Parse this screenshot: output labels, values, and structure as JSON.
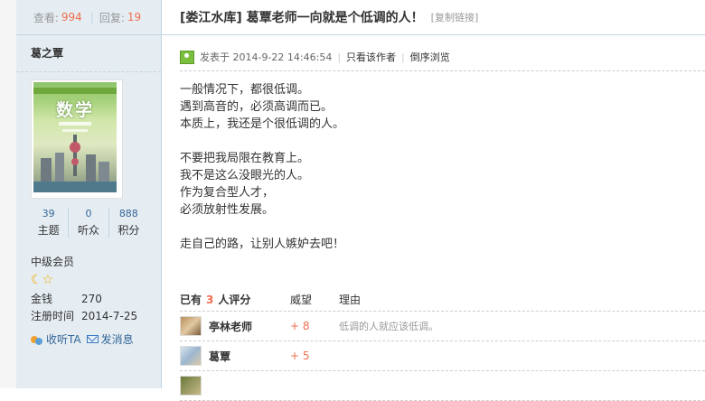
{
  "stats": {
    "views_label": "查看:",
    "views": "994",
    "replies_label": "回复:",
    "replies": "19"
  },
  "author": {
    "name": "葛之覃",
    "book_title": "数学",
    "counts": [
      {
        "value": "39",
        "label": "主题"
      },
      {
        "value": "0",
        "label": "听众"
      },
      {
        "value": "888",
        "label": "积分"
      }
    ],
    "level": "中级会员",
    "info": [
      {
        "key": "金钱",
        "value": "270"
      },
      {
        "key": "注册时间",
        "value": "2014-7-25"
      }
    ],
    "actions": {
      "follow": "收听TA",
      "message": "发消息"
    }
  },
  "thread": {
    "title": "[娄江水库] 葛覃老师一向就是个低调的人！",
    "copy_link": "[复制链接]"
  },
  "post": {
    "posted_at": "发表于 2014-9-22 14:46:54",
    "only_author": "只看该作者",
    "reverse": "倒序浏览",
    "lines": [
      "一般情况下，都很低调。",
      "遇到高音的，必须高调而已。",
      "本质上，我还是个很低调的人。",
      "",
      "不要把我局限在教育上。",
      "我不是这么没眼光的人。",
      "作为复合型人才，",
      "必须放射性发展。",
      "",
      "走自己的路，让别人嫉妒去吧！"
    ]
  },
  "rating": {
    "prefix": "已有",
    "count": "3",
    "suffix": "人评分",
    "col_prestige": "威望",
    "col_reason": "理由",
    "rows": [
      {
        "user": "亭林老师",
        "score": "+ 8",
        "reason": "低调的人就应该低调。"
      },
      {
        "user": "葛覃",
        "score": "+ 5",
        "reason": ""
      }
    ]
  }
}
